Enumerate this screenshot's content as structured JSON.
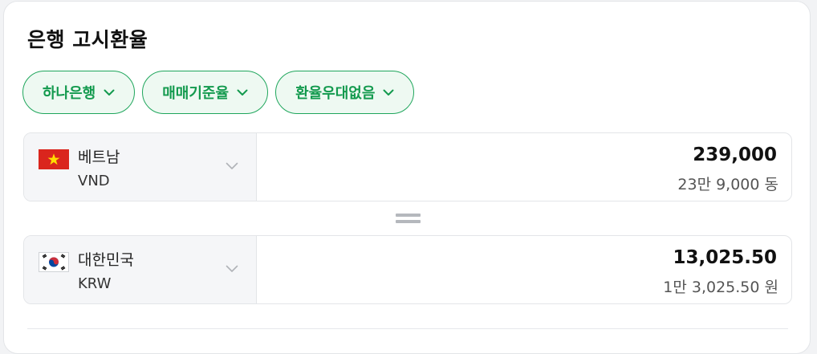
{
  "title": "은행 고시환율",
  "filters": [
    {
      "label": "하나은행",
      "icon": "chevron-down-icon"
    },
    {
      "label": "매매기준율",
      "icon": "chevron-down-icon"
    },
    {
      "label": "환율우대없음",
      "icon": "chevron-down-icon"
    }
  ],
  "from": {
    "flag": "vietnam-flag-icon",
    "country": "베트남",
    "code": "VND",
    "amount": "239,000",
    "amount_korean": "23만 9,000 동"
  },
  "to": {
    "flag": "korea-flag-icon",
    "country": "대한민국",
    "code": "KRW",
    "amount": "13,025.50",
    "amount_korean": "1만 3,025.50 원"
  },
  "equals_icon": "equals-icon",
  "colors": {
    "accent_green": "#139a4e",
    "chip_background": "#eef9f2",
    "vietnam_red": "#da251d",
    "vietnam_star": "#ffde00"
  }
}
